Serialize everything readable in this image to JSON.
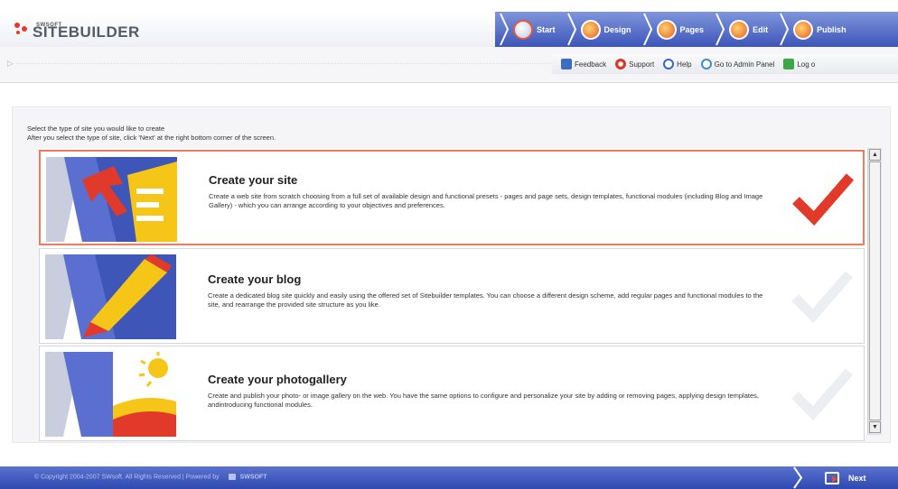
{
  "header": {
    "logo_small": "SWSOFT",
    "logo_text": "SITEBUILDER",
    "steps": [
      {
        "label": "Start"
      },
      {
        "label": "Design"
      },
      {
        "label": "Pages"
      },
      {
        "label": "Edit"
      },
      {
        "label": "Publish"
      }
    ]
  },
  "toolbar": {
    "links": [
      {
        "label": "Feedback",
        "icon": "feedback-icon",
        "color": "#3a6cc8"
      },
      {
        "label": "Support",
        "icon": "support-icon",
        "color": "#d33a2a"
      },
      {
        "label": "Help",
        "icon": "help-icon",
        "color": "#3566c4"
      },
      {
        "label": "Go to Admin Panel",
        "icon": "admin-panel-icon",
        "color": "#3a8bd6"
      },
      {
        "label": "Log o",
        "icon": "logout-icon",
        "color": "#3aa845"
      }
    ]
  },
  "main": {
    "instruction_line1": "Select the type of site you would like to create",
    "instruction_line2": "After you select the type of site, click 'Next' at the right bottom corner of the screen.",
    "options": [
      {
        "title": "Create your site",
        "description": "Create a web site from scratch choosing from a full set of available design and functional presets - pages and page sets, design templates, functional modules (including Blog and Image Gallery) - which you can arrange according to your objectives and preferences.",
        "selected": true,
        "icon": "create-site-icon"
      },
      {
        "title": "Create your blog",
        "description": "Create a dedicated blog site quickly and easily using the offered set of Sitebuilder templates. You can choose a different design scheme, add regular pages and functional modules to the site, and rearrange the provided site structure as you like.",
        "selected": false,
        "icon": "create-blog-icon"
      },
      {
        "title": "Create your photogallery",
        "description": "Create and publish your photo- or image gallery on the web. You have the same options to configure and personalize your site by adding or removing pages, applying design templates, andintroducing functional modules.",
        "selected": false,
        "icon": "create-photogallery-icon"
      }
    ]
  },
  "footer": {
    "copyright": "© Copyright 2004-2007 SWsoft. All Rights Reserved | Powered by",
    "powered_by": "SWSOFT",
    "next_label": "Next"
  },
  "colors": {
    "accent_blue": "#3d56b8",
    "selected_border": "#f07a60",
    "check_red": "#e23a2a"
  }
}
